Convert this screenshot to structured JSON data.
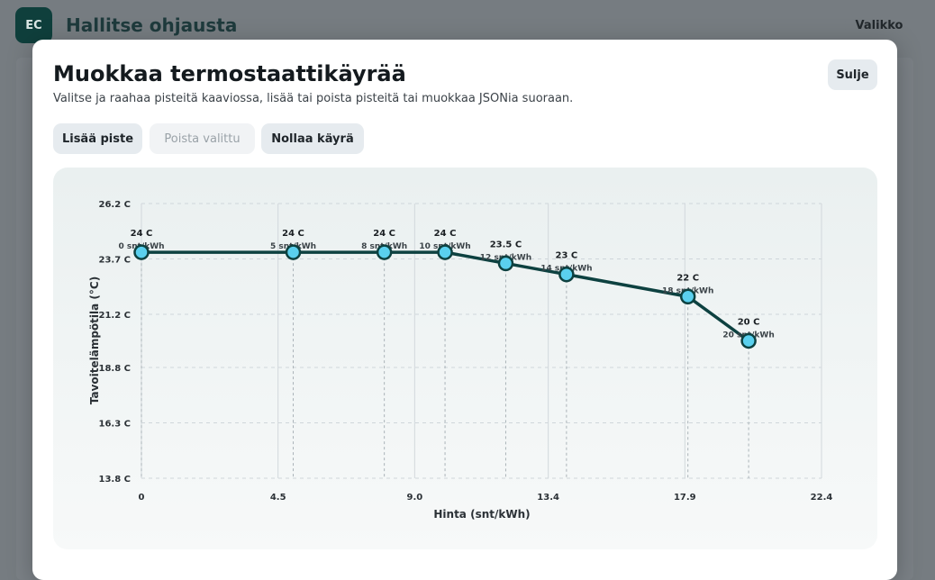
{
  "app": {
    "logo_text": "EC",
    "title": "Hallitse ohjausta",
    "menu_label": "Valikko"
  },
  "modal": {
    "title": "Muokkaa termostaattikäyrää",
    "description": "Valitse ja raahaa pisteitä kaaviossa, lisää tai poista pisteitä tai muokkaa JSONia suoraan.",
    "close_label": "Sulje",
    "add_label": "Lisää piste",
    "remove_label": "Poista valittu",
    "remove_disabled": true,
    "reset_label": "Nollaa käyrä"
  },
  "chart_data": {
    "type": "line",
    "xlabel": "Hinta (snt/kWh)",
    "ylabel": "Tavoitelämpötila (°C)",
    "xlim": [
      0,
      22.4
    ],
    "ylim": [
      13.8,
      26.2
    ],
    "xticks": [
      0,
      4.5,
      9.0,
      13.4,
      17.9,
      22.4
    ],
    "xtick_labels": [
      "0",
      "4.5",
      "9.0",
      "13.4",
      "17.9",
      "22.4"
    ],
    "yticks": [
      13.8,
      16.3,
      18.8,
      21.2,
      23.7,
      26.2
    ],
    "ytick_labels": [
      "13.8 C",
      "16.3 C",
      "18.8 C",
      "21.2 C",
      "23.7 C",
      "26.2 C"
    ],
    "grid": true,
    "line_color": "#0d4140",
    "point_color": "#5ad0ee",
    "points": [
      {
        "x": 0,
        "y": 24,
        "temp_label": "24 C",
        "price_label": "0 snt/kWh"
      },
      {
        "x": 5,
        "y": 24,
        "temp_label": "24 C",
        "price_label": "5 snt/kWh"
      },
      {
        "x": 8,
        "y": 24,
        "temp_label": "24 C",
        "price_label": "8 snt/kWh"
      },
      {
        "x": 10,
        "y": 24,
        "temp_label": "24 C",
        "price_label": "10 snt/kWh"
      },
      {
        "x": 12,
        "y": 23.5,
        "temp_label": "23.5 C",
        "price_label": "12 snt/kWh"
      },
      {
        "x": 14,
        "y": 23,
        "temp_label": "23 C",
        "price_label": "14 snt/kWh"
      },
      {
        "x": 18,
        "y": 22,
        "temp_label": "22 C",
        "price_label": "18 snt/kWh"
      },
      {
        "x": 20,
        "y": 20,
        "temp_label": "20 C",
        "price_label": "20 snt/kWh"
      }
    ]
  }
}
